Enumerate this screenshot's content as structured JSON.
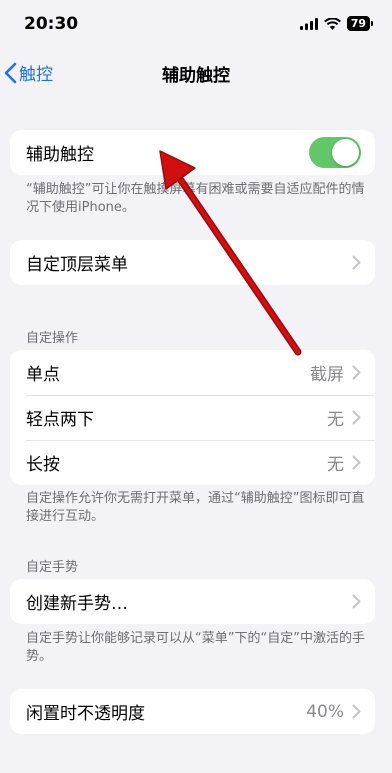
{
  "status_bar": {
    "time": "20:30",
    "battery": "79"
  },
  "nav": {
    "back_label": "触控",
    "title": "辅助触控"
  },
  "toggle_section": {
    "label": "辅助触控",
    "enabled": true,
    "footer": "“辅助触控”可让你在触摸屏幕有困难或需要自适应配件的情况下使用iPhone。"
  },
  "top_menu": {
    "label": "自定顶层菜单"
  },
  "custom_actions": {
    "header": "自定操作",
    "rows": [
      {
        "label": "单点",
        "value": "截屏"
      },
      {
        "label": "轻点两下",
        "value": "无"
      },
      {
        "label": "长按",
        "value": "无"
      }
    ],
    "footer": "自定操作允许你无需打开菜单，通过“辅助触控”图标即可直接进行互动。"
  },
  "custom_gestures": {
    "header": "自定手势",
    "create_label": "创建新手势…",
    "footer": "自定手势让你能够记录可以从“菜单”下的“自定”中激活的手势。"
  },
  "idle_opacity": {
    "label": "闲置时不透明度",
    "value": "40%"
  },
  "colors": {
    "accent": "#1a73e8",
    "toggle_on": "#63c76a",
    "annotation_arrow": "#d01010"
  }
}
